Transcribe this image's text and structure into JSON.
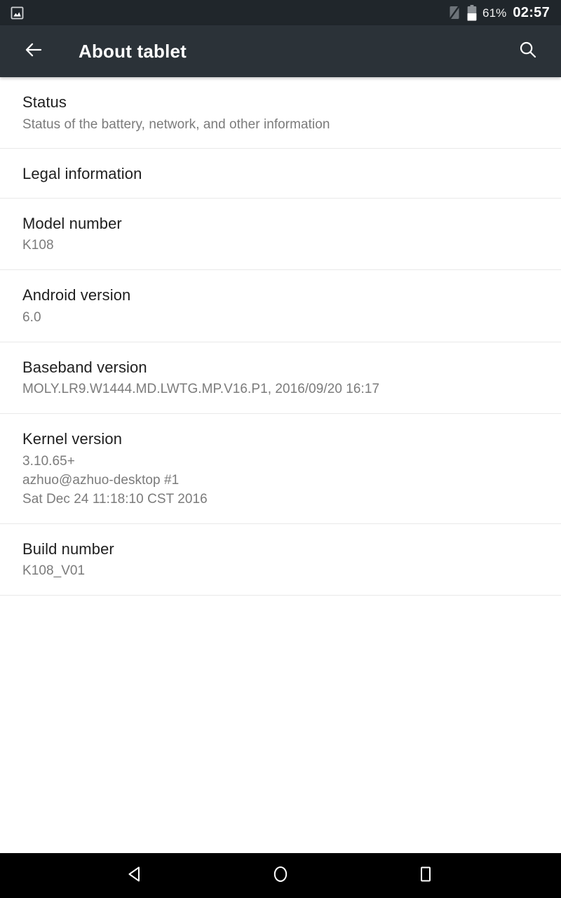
{
  "status_bar": {
    "notification_icons": [
      "screenshot-image-icon"
    ],
    "no_sim_icon": "no-sim-icon",
    "battery_icon": "battery-icon",
    "battery_percent": "61%",
    "battery_level": 61,
    "clock": "02:57"
  },
  "app_bar": {
    "back_icon": "back-arrow-icon",
    "title": "About tablet",
    "search_icon": "search-icon"
  },
  "settings": {
    "items": [
      {
        "title": "Status",
        "summary": "Status of the battery, network, and other information"
      },
      {
        "title": "Legal information",
        "summary": ""
      },
      {
        "title": "Model number",
        "summary": "K108"
      },
      {
        "title": "Android version",
        "summary": "6.0"
      },
      {
        "title": "Baseband version",
        "summary": "MOLY.LR9.W1444.MD.LWTG.MP.V16.P1, 2016/09/20 16:17"
      },
      {
        "title": "Kernel version",
        "summary": "3.10.65+\nazhuo@azhuo-desktop #1\nSat Dec 24 11:18:10 CST 2016"
      },
      {
        "title": "Build number",
        "summary": "K108_V01"
      }
    ]
  },
  "nav_bar": {
    "back_label": "back-triangle-icon",
    "home_label": "home-circle-icon",
    "recents_label": "recents-square-icon"
  },
  "colors": {
    "status_bar_bg": "#20262b",
    "app_bar_bg": "#2b3238",
    "page_bg": "#ffffff",
    "primary_text": "#1f1f1f",
    "secondary_text": "#7b7b7b",
    "divider": "#e9e9e9",
    "nav_bar_bg": "#000000"
  }
}
